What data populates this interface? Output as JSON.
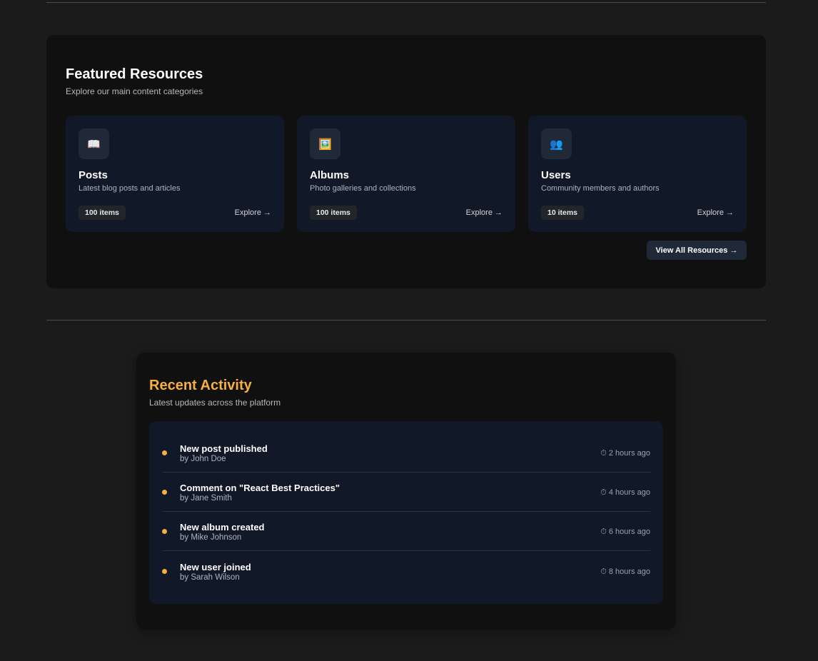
{
  "featured": {
    "title": "Featured Resources",
    "subtitle": "Explore our main content categories",
    "cards": [
      {
        "icon": "book-icon",
        "glyph": "📖",
        "title": "Posts",
        "description": "Latest blog posts and articles",
        "count": "100 items",
        "explore": "Explore →"
      },
      {
        "icon": "picture-icon",
        "glyph": "🖼️",
        "title": "Albums",
        "description": "Photo galleries and collections",
        "count": "100 items",
        "explore": "Explore →"
      },
      {
        "icon": "users-icon",
        "glyph": "👥",
        "title": "Users",
        "description": "Community members and authors",
        "count": "10 items",
        "explore": "Explore →"
      }
    ],
    "view_all": "View All Resources →"
  },
  "activity": {
    "title": "Recent Activity",
    "subtitle": "Latest updates across the platform",
    "items": [
      {
        "title": "New post published",
        "by": "by John Doe",
        "time": "⏱ 2 hours ago"
      },
      {
        "title": "Comment on \"React Best Practices\"",
        "by": "by Jane Smith",
        "time": "⏱ 4 hours ago"
      },
      {
        "title": "New album created",
        "by": "by Mike Johnson",
        "time": "⏱ 6 hours ago"
      },
      {
        "title": "New user joined",
        "by": "by Sarah Wilson",
        "time": "⏱ 8 hours ago"
      }
    ]
  },
  "colors": {
    "background": "#1b1b1b",
    "card_bg": "#111827",
    "accent": "#f5b041"
  }
}
